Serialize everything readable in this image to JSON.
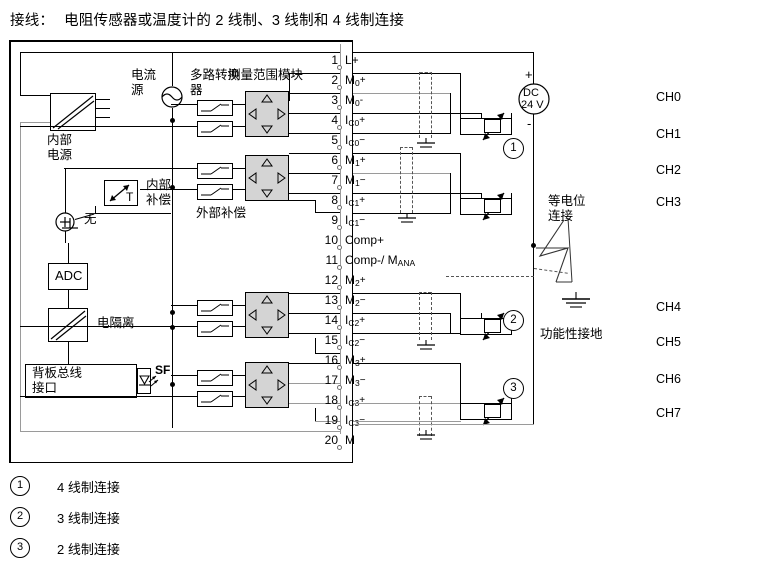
{
  "title": {
    "prefix": "接线：",
    "text": "电阻传感器或温度计的 2 线制、3 线制和 4 线制连接"
  },
  "module_labels": {
    "internal_supply": "内部\n电源",
    "internal_supply_l1": "内部",
    "internal_supply_l2": "电源",
    "current_source_l1": "电流",
    "current_source_l2": "源",
    "mux_l1": "多路转换",
    "mux_l2": "器",
    "range_module_l1": "测量范围模块",
    "internal_comp_l1": "内部",
    "internal_comp_l2": "补偿",
    "external_comp": "外部补偿",
    "none": "无",
    "adc": "ADC",
    "isolation": "电隔离",
    "backplane_l1": "背板总线",
    "backplane_l2": "接口",
    "sf": "SF",
    "temp_sensor": "T"
  },
  "terminals": [
    {
      "no": "1",
      "name": "L+",
      "sub": "",
      "sup": ""
    },
    {
      "no": "2",
      "name": "M",
      "sub": "0",
      "sup": "+"
    },
    {
      "no": "3",
      "name": "M",
      "sub": "0",
      "sup": "-"
    },
    {
      "no": "4",
      "name": "I",
      "sub": "C0",
      "sup": "+"
    },
    {
      "no": "5",
      "name": "I",
      "sub": "C0",
      "sup": "−"
    },
    {
      "no": "6",
      "name": "M",
      "sub": "1",
      "sup": "+"
    },
    {
      "no": "7",
      "name": "M",
      "sub": "1",
      "sup": "−"
    },
    {
      "no": "8",
      "name": "I",
      "sub": "C1",
      "sup": "+"
    },
    {
      "no": "9",
      "name": "I",
      "sub": "C1",
      "sup": "−"
    },
    {
      "no": "10",
      "name": "Comp+",
      "sub": "",
      "sup": ""
    },
    {
      "no": "11",
      "name": "Comp-/ M",
      "sub": "ANA",
      "sup": ""
    },
    {
      "no": "12",
      "name": "M",
      "sub": "2",
      "sup": "+"
    },
    {
      "no": "13",
      "name": "M",
      "sub": "2",
      "sup": "−"
    },
    {
      "no": "14",
      "name": "I",
      "sub": "C2",
      "sup": "+"
    },
    {
      "no": "15",
      "name": "I",
      "sub": "C2",
      "sup": "−"
    },
    {
      "no": "16",
      "name": "M",
      "sub": "3",
      "sup": "+"
    },
    {
      "no": "17",
      "name": "M",
      "sub": "3",
      "sup": "−"
    },
    {
      "no": "18",
      "name": "I",
      "sub": "C3",
      "sup": "+"
    },
    {
      "no": "19",
      "name": "I",
      "sub": "C3",
      "sup": "−"
    },
    {
      "no": "20",
      "name": "M",
      "sub": "",
      "sup": ""
    }
  ],
  "channels": [
    "CH0",
    "CH1",
    "CH2",
    "CH3",
    "CH4",
    "CH5",
    "CH6",
    "CH7"
  ],
  "supply": {
    "label_l1": "DC",
    "label_l2": "24 V",
    "plus": "+",
    "minus": "-"
  },
  "ground": {
    "equipotential_l1": "等电位",
    "equipotential_l2": "连接",
    "functional_earth": "功能性接地"
  },
  "callouts": [
    "1",
    "2",
    "3"
  ],
  "legend": [
    {
      "marker": "①",
      "num": "1",
      "text": "4 线制连接"
    },
    {
      "marker": "②",
      "num": "2",
      "text": "3 线制连接"
    },
    {
      "marker": "③",
      "num": "3",
      "text": "2 线制连接"
    }
  ],
  "colors": {
    "wire_black": "#000000",
    "wire_gray": "#9a9a9a",
    "mux_fill": "#d4d4d4",
    "background": "#ffffff"
  }
}
